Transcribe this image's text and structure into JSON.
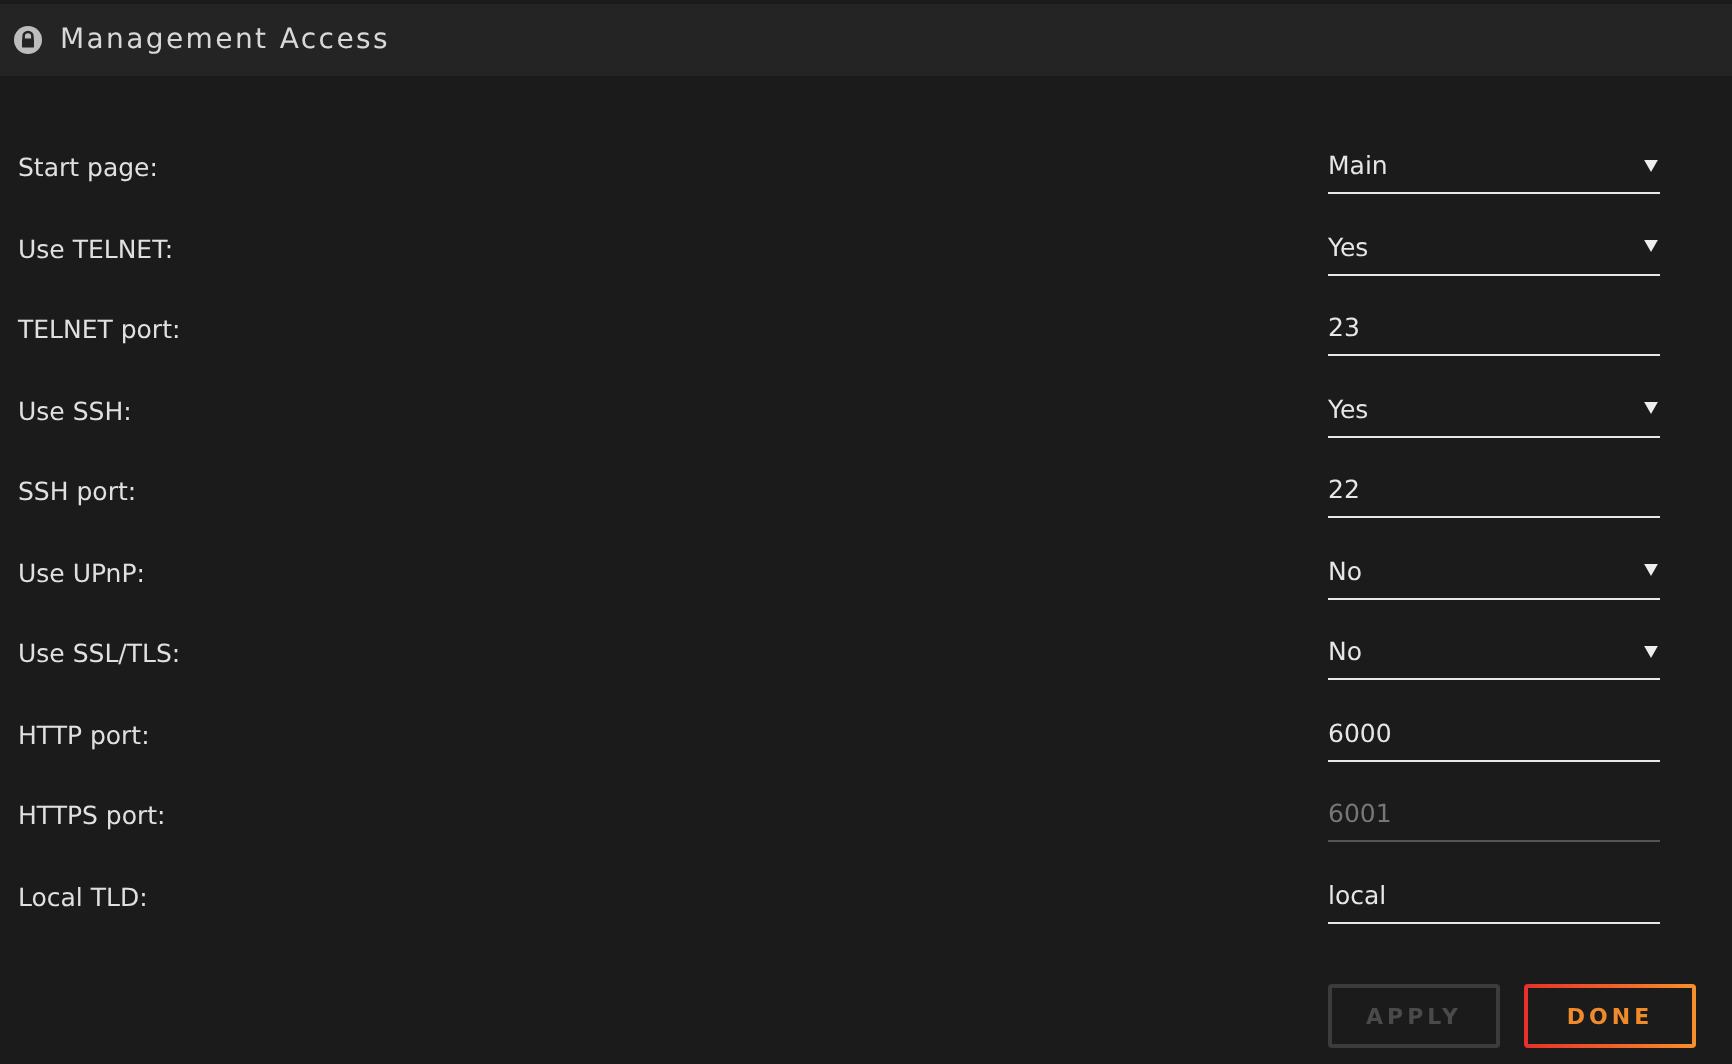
{
  "header": {
    "title": "Management Access"
  },
  "rows": [
    {
      "label": "Start page:",
      "kind": "select",
      "value": "Main",
      "disabled": false
    },
    {
      "label": "Use TELNET:",
      "kind": "select",
      "value": "Yes",
      "disabled": false
    },
    {
      "label": "TELNET port:",
      "kind": "text",
      "value": "23",
      "disabled": false
    },
    {
      "label": "Use SSH:",
      "kind": "select",
      "value": "Yes",
      "disabled": false
    },
    {
      "label": "SSH port:",
      "kind": "text",
      "value": "22",
      "disabled": false
    },
    {
      "label": "Use UPnP:",
      "kind": "select",
      "value": "No",
      "disabled": false
    },
    {
      "label": "Use SSL/TLS:",
      "kind": "select",
      "value": "No",
      "disabled": false
    },
    {
      "label": "HTTP port:",
      "kind": "text",
      "value": "6000",
      "disabled": false
    },
    {
      "label": "HTTPS port:",
      "kind": "text",
      "value": "6001",
      "disabled": true
    },
    {
      "label": "Local TLD:",
      "kind": "text",
      "value": "local",
      "disabled": false
    }
  ],
  "buttons": [
    {
      "label": "APPLY",
      "disabled": true
    },
    {
      "label": "DONE",
      "disabled": false
    }
  ]
}
